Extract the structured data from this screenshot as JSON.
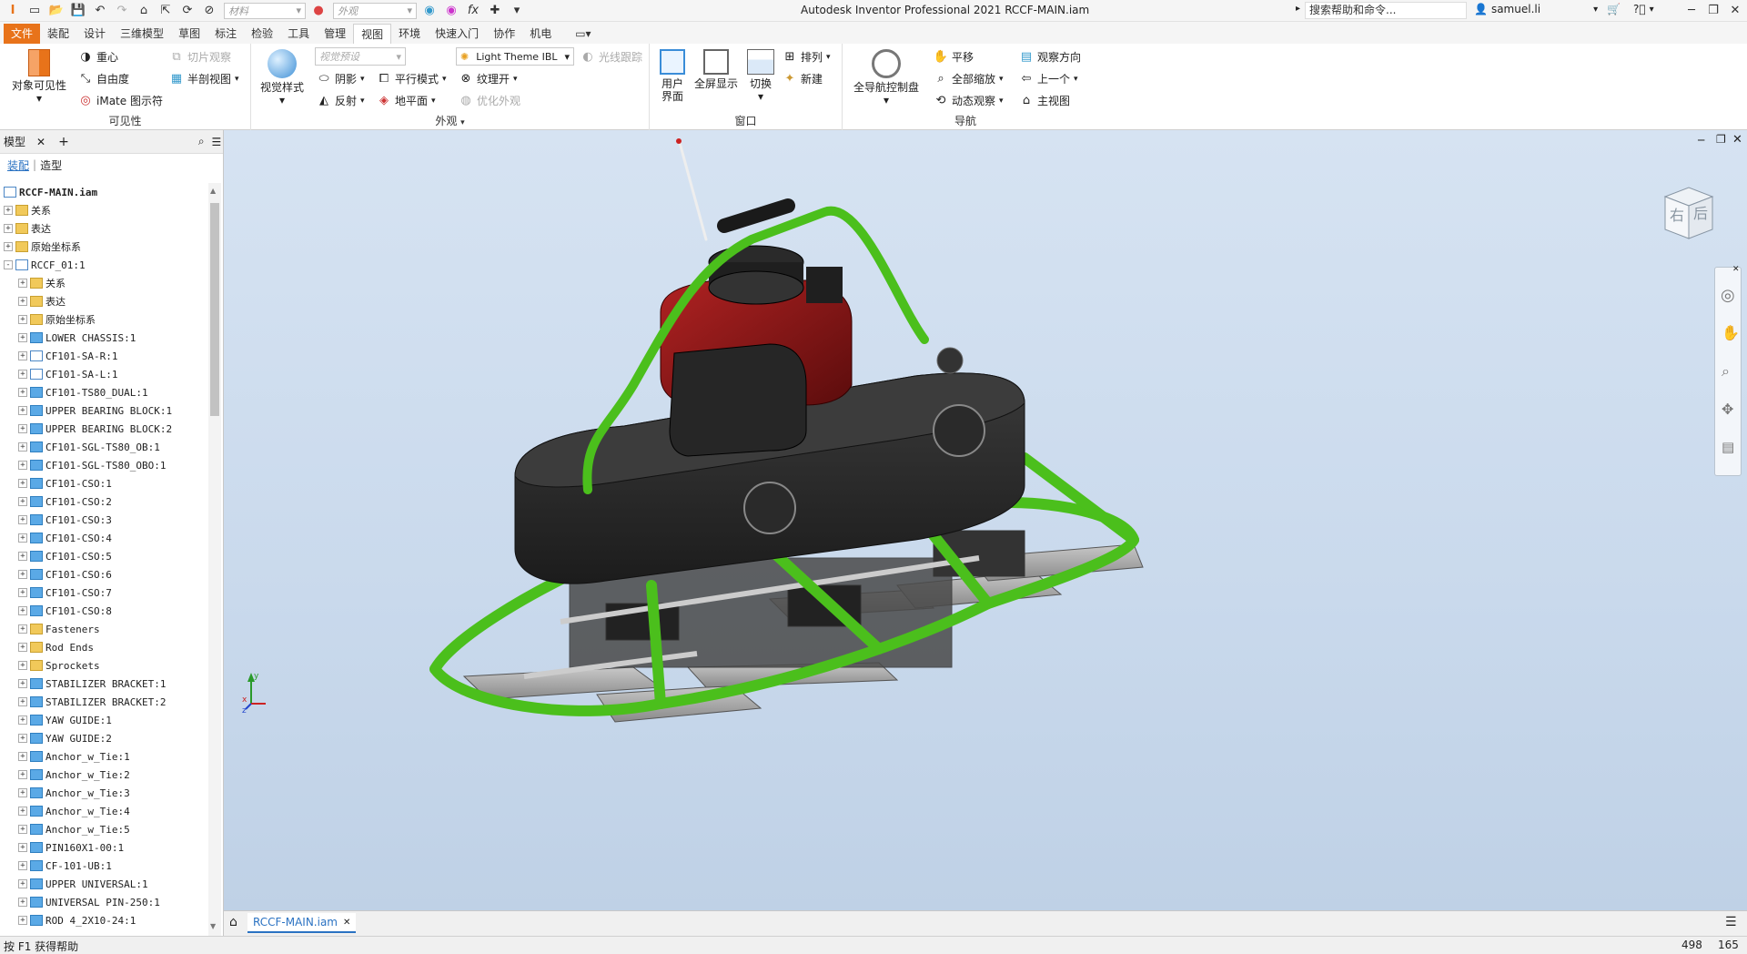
{
  "app": {
    "title": "Autodesk Inventor Professional 2021   RCCF-MAIN.iam"
  },
  "quick_access": {
    "material_placeholder": "材料",
    "appearance_placeholder": "外观"
  },
  "search": {
    "placeholder": "搜索帮助和命令..."
  },
  "user": {
    "name": "samuel.li"
  },
  "tabs": [
    "文件",
    "装配",
    "设计",
    "三维模型",
    "草图",
    "标注",
    "检验",
    "工具",
    "管理",
    "视图",
    "环境",
    "快速入门",
    "协作",
    "机电"
  ],
  "active_tab": "视图",
  "ribbon": {
    "visibility": {
      "title": "可见性",
      "object_visibility": "对象可见性",
      "center_of_gravity": "重心",
      "dof": "自由度",
      "imate": "iMate 图示符",
      "slice": "切片观察",
      "half_section": "半剖视图"
    },
    "appearance": {
      "title": "外观",
      "visual_style": "视觉样式",
      "view_preset": "视觉预设",
      "light_theme": "Light Theme IBL",
      "ray_tracing": "光线跟踪",
      "shadows": "阴影",
      "parallel": "平行模式",
      "texture": "纹理开",
      "reflection": "反射",
      "ground": "地平面",
      "optimize": "优化外观"
    },
    "window": {
      "title": "窗口",
      "user_interface": "用户界面",
      "fullscreen": "全屏显示",
      "switch": "切换",
      "arrange": "排列",
      "new": "新建"
    },
    "navigate": {
      "title": "导航",
      "steering_wheel": "全导航控制盘",
      "pan": "平移",
      "zoom_all": "全部缩放",
      "orbit": "动态观察",
      "look_at": "观察方向",
      "previous": "上一个",
      "home": "主视图"
    }
  },
  "browser": {
    "tab": "模型",
    "mode_assembly": "装配",
    "mode_modeling": "造型",
    "items": [
      {
        "label": "RCCF-MAIN.iam",
        "icon": "assembly-file",
        "indent": 0,
        "exp": ""
      },
      {
        "label": "关系",
        "icon": "folder",
        "indent": 0,
        "exp": "+"
      },
      {
        "label": "表达",
        "icon": "folder",
        "indent": 0,
        "exp": "+"
      },
      {
        "label": "原始坐标系",
        "icon": "folder",
        "indent": 0,
        "exp": "+"
      },
      {
        "label": "RCCF_01:1",
        "icon": "assembly",
        "indent": 0,
        "exp": "-"
      },
      {
        "label": "关系",
        "icon": "folder",
        "indent": 1,
        "exp": "+"
      },
      {
        "label": "表达",
        "icon": "folder",
        "indent": 1,
        "exp": "+"
      },
      {
        "label": "原始坐标系",
        "icon": "folder",
        "indent": 1,
        "exp": "+"
      },
      {
        "label": "LOWER CHASSIS:1",
        "icon": "part",
        "indent": 1,
        "exp": "+"
      },
      {
        "label": "CF101-SA-R:1",
        "icon": "assembly",
        "indent": 1,
        "exp": "+"
      },
      {
        "label": "CF101-SA-L:1",
        "icon": "assembly",
        "indent": 1,
        "exp": "+"
      },
      {
        "label": "CF101-TS80_DUAL:1",
        "icon": "part",
        "indent": 1,
        "exp": "+"
      },
      {
        "label": "UPPER BEARING BLOCK:1",
        "icon": "part",
        "indent": 1,
        "exp": "+"
      },
      {
        "label": "UPPER BEARING BLOCK:2",
        "icon": "part",
        "indent": 1,
        "exp": "+"
      },
      {
        "label": "CF101-SGL-TS80_OB:1",
        "icon": "part",
        "indent": 1,
        "exp": "+"
      },
      {
        "label": "CF101-SGL-TS80_OBO:1",
        "icon": "part",
        "indent": 1,
        "exp": "+"
      },
      {
        "label": "CF101-CSO:1",
        "icon": "part",
        "indent": 1,
        "exp": "+"
      },
      {
        "label": "CF101-CSO:2",
        "icon": "part",
        "indent": 1,
        "exp": "+"
      },
      {
        "label": "CF101-CSO:3",
        "icon": "part",
        "indent": 1,
        "exp": "+"
      },
      {
        "label": "CF101-CSO:4",
        "icon": "part",
        "indent": 1,
        "exp": "+"
      },
      {
        "label": "CF101-CSO:5",
        "icon": "part",
        "indent": 1,
        "exp": "+"
      },
      {
        "label": "CF101-CSO:6",
        "icon": "part",
        "indent": 1,
        "exp": "+"
      },
      {
        "label": "CF101-CSO:7",
        "icon": "part",
        "indent": 1,
        "exp": "+"
      },
      {
        "label": "CF101-CSO:8",
        "icon": "part",
        "indent": 1,
        "exp": "+"
      },
      {
        "label": "Fasteners",
        "icon": "folder",
        "indent": 1,
        "exp": "+"
      },
      {
        "label": "Rod Ends",
        "icon": "folder",
        "indent": 1,
        "exp": "+"
      },
      {
        "label": "Sprockets",
        "icon": "folder",
        "indent": 1,
        "exp": "+"
      },
      {
        "label": "STABILIZER BRACKET:1",
        "icon": "part",
        "indent": 1,
        "exp": "+"
      },
      {
        "label": "STABILIZER BRACKET:2",
        "icon": "part",
        "indent": 1,
        "exp": "+"
      },
      {
        "label": "YAW GUIDE:1",
        "icon": "part",
        "indent": 1,
        "exp": "+"
      },
      {
        "label": "YAW GUIDE:2",
        "icon": "part",
        "indent": 1,
        "exp": "+"
      },
      {
        "label": "Anchor_w_Tie:1",
        "icon": "part",
        "indent": 1,
        "exp": "+"
      },
      {
        "label": "Anchor_w_Tie:2",
        "icon": "part",
        "indent": 1,
        "exp": "+"
      },
      {
        "label": "Anchor_w_Tie:3",
        "icon": "part",
        "indent": 1,
        "exp": "+"
      },
      {
        "label": "Anchor_w_Tie:4",
        "icon": "part",
        "indent": 1,
        "exp": "+"
      },
      {
        "label": "Anchor_w_Tie:5",
        "icon": "part",
        "indent": 1,
        "exp": "+"
      },
      {
        "label": "PIN160X1-00:1",
        "icon": "part",
        "indent": 1,
        "exp": "+"
      },
      {
        "label": "CF-101-UB:1",
        "icon": "part",
        "indent": 1,
        "exp": "+"
      },
      {
        "label": "UPPER UNIVERSAL:1",
        "icon": "part",
        "indent": 1,
        "exp": "+"
      },
      {
        "label": "UNIVERSAL PIN-250:1",
        "icon": "part",
        "indent": 1,
        "exp": "+"
      },
      {
        "label": "ROD 4_2X10-24:1",
        "icon": "part",
        "indent": 1,
        "exp": "+"
      }
    ]
  },
  "viewcube": {
    "face_right": "右",
    "face_back": "后"
  },
  "triad": {
    "x": "x",
    "y": "y",
    "z": "z"
  },
  "document_tab": "RCCF-MAIN.iam",
  "status": {
    "hint": "按 F1 获得帮助",
    "num1": "498",
    "num2": "165"
  },
  "colors": {
    "file_tab": "#e8731a",
    "frame_green": "#5ccc28",
    "engine_red": "#8a1414",
    "body_dark": "#2b2b2b"
  }
}
